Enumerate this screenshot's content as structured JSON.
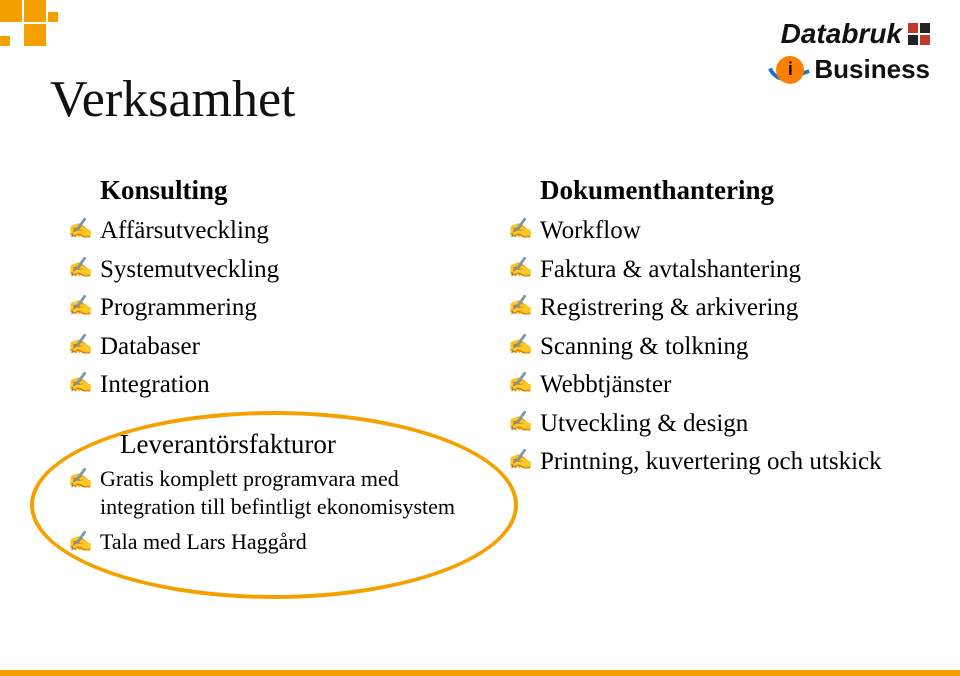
{
  "title": "Verksamhet",
  "logos": {
    "databruk": "Databruk",
    "ibusiness": "Business"
  },
  "left": {
    "heading": "Konsulting",
    "items": [
      "Affärsutveckling",
      "Systemutveckling",
      "Programmering",
      "Databaser",
      "Integration"
    ],
    "callout": {
      "heading": "Leverantörsfakturor",
      "items": [
        "Gratis komplett programvara med integration till befintligt ekonomisystem",
        "Tala med Lars Haggård"
      ]
    }
  },
  "right": {
    "heading": "Dokumenthantering",
    "items": [
      "Workflow",
      "Faktura & avtalshantering",
      "Registrering & arkivering",
      "Scanning & tolkning",
      "Webbtjänster",
      "Utveckling & design",
      "Printning, kuvertering och utskick"
    ]
  },
  "colors": {
    "accent": "#f4a100",
    "text": "#000000"
  }
}
